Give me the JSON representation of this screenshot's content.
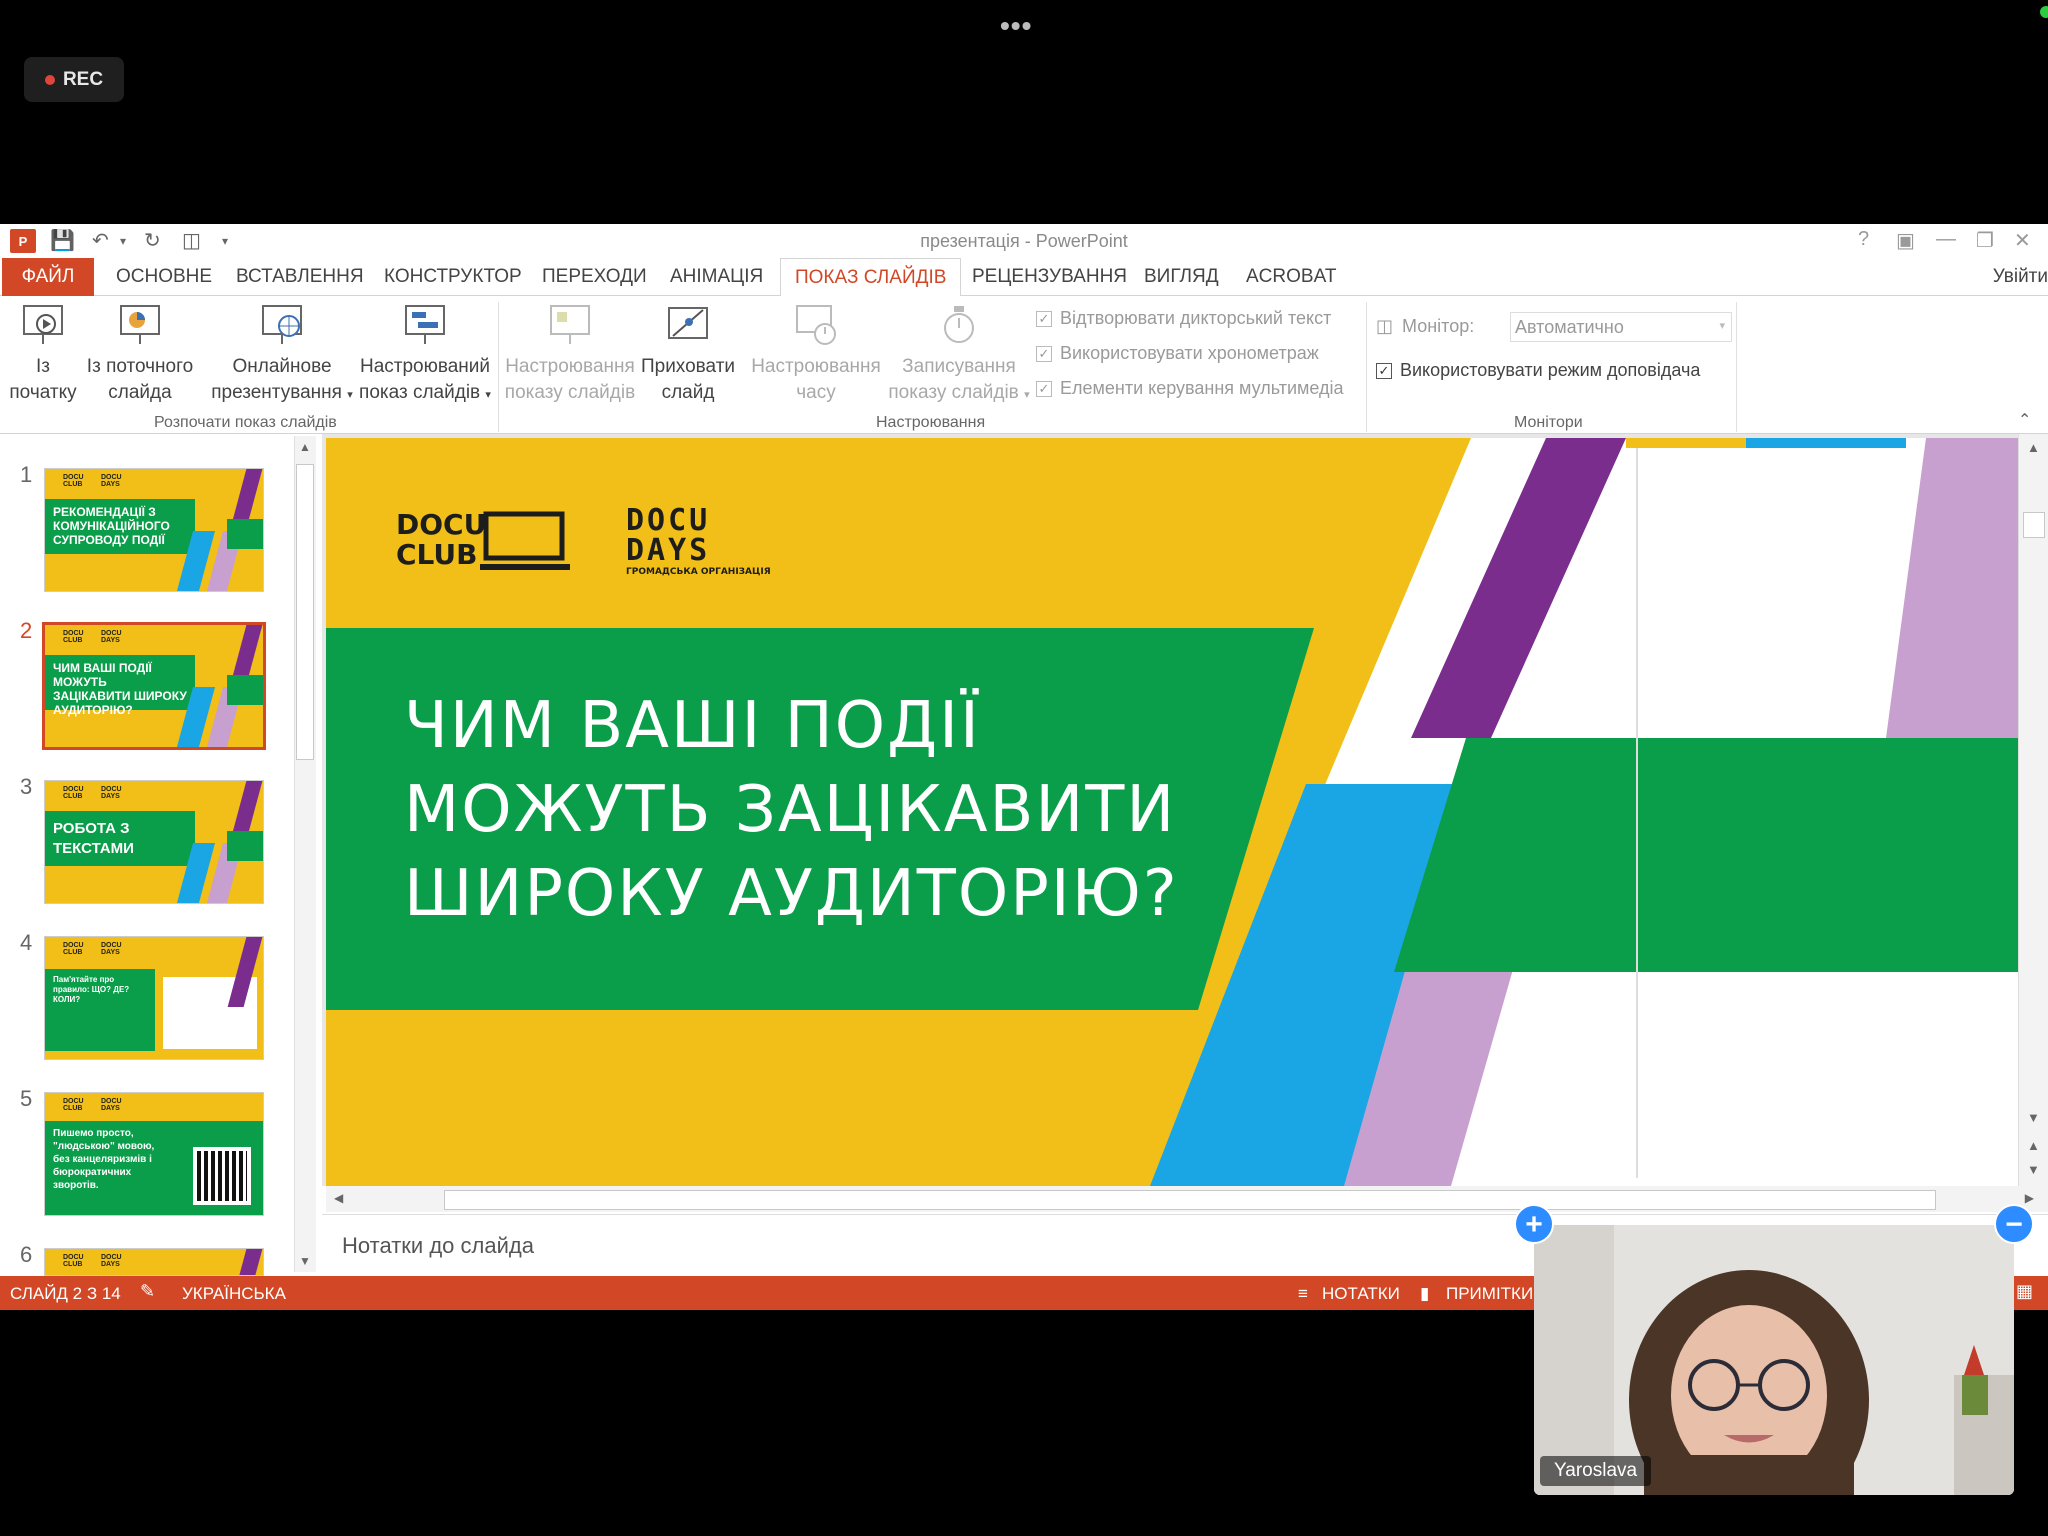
{
  "zoom": {
    "rec_label": "REC",
    "participant_name": "Yaroslava",
    "more_dots": "•••",
    "plus_label": "+",
    "minus_label": "−"
  },
  "window": {
    "title": "презентація - PowerPoint",
    "app_icon": "P"
  },
  "tabs": [
    {
      "label": "ФАЙЛ"
    },
    {
      "label": "ОСНОВНЕ"
    },
    {
      "label": "ВСТАВЛЕННЯ"
    },
    {
      "label": "КОНСТРУКТОР"
    },
    {
      "label": "ПЕРЕХОДИ"
    },
    {
      "label": "АНІМАЦІЯ"
    },
    {
      "label": "ПОКАЗ СЛАЙДІВ"
    },
    {
      "label": "РЕЦЕНЗУВАННЯ"
    },
    {
      "label": "ВИГЛЯД"
    },
    {
      "label": "ACROBAT"
    }
  ],
  "active_tab": "ПОКАЗ СЛАЙДІВ",
  "sign_in": "Увійти",
  "ribbon": {
    "from_start": [
      "Із",
      "початку"
    ],
    "from_current": [
      "Із поточного",
      "слайда"
    ],
    "online": [
      "Онлайнове",
      "презентування"
    ],
    "custom_show": [
      "Настроюваний",
      "показ слайдів"
    ],
    "setup_show": [
      "Настроювання",
      "показу слайдів"
    ],
    "hide_slide": [
      "Приховати",
      "слайд"
    ],
    "rehearse": [
      "Настроювання",
      "часу"
    ],
    "record": [
      "Записування",
      "показу слайдів"
    ],
    "play_narrations": "Відтворювати дикторський текст",
    "use_timings": "Використовувати хронометраж",
    "show_media": "Елементи керування мультимедіа",
    "monitor_label": "Монітор:",
    "monitor_value": "Автоматично",
    "presenter_view": "Використовувати режим доповідача",
    "group_start": "Розпочати показ слайдів",
    "group_setup": "Настроювання",
    "group_monitors": "Монітори"
  },
  "slides": [
    {
      "num": "1",
      "text": "РЕКОМЕНДАЦІЇ З КОМУНІКАЦІЙНОГО СУПРОВОДУ ПОДІЇ"
    },
    {
      "num": "2",
      "text": "ЧИМ ВАШІ ПОДІЇ МОЖУТЬ ЗАЦІКАВИТИ ШИРОКУ АУДИТОРІЮ?"
    },
    {
      "num": "3",
      "text": "РОБОТА З ТЕКСТАМИ"
    },
    {
      "num": "4",
      "text": "Пам'ятайте про правило: ЩО? ДЕ? КОЛИ?"
    },
    {
      "num": "5",
      "text": "Пишемо просто, \"людською\" мовою, без канцеляризмів і бюрократичних зворотів."
    },
    {
      "num": "6",
      "text": ""
    }
  ],
  "current_slide": {
    "logo_left": [
      "DOCU",
      "CLUB"
    ],
    "logo_right": [
      "DOCU",
      "DAYS"
    ],
    "logo_right_sub": "ГРОМАДСЬКА ОРГАНІЗАЦІЯ",
    "headline": [
      "ЧИМ ВАШІ ПОДІЇ",
      "МОЖУТЬ ЗАЦІКАВИТИ",
      "ШИРОКУ АУДИТОРІЮ?"
    ]
  },
  "notes_placeholder": "Нотатки до слайда",
  "status": {
    "slide_info": "СЛАЙД 2 З 14",
    "language": "УКРАЇНСЬКА",
    "notes": "НОТАТКИ",
    "comments": "ПРИМІТКИ"
  },
  "colors": {
    "accent": "#d24726",
    "slide_yellow": "#f1bf17",
    "slide_green": "#0b9e4a",
    "slide_blue": "#1aa5e5",
    "slide_purple": "#7b2d8e",
    "slide_lilac": "#c7a0cf"
  }
}
